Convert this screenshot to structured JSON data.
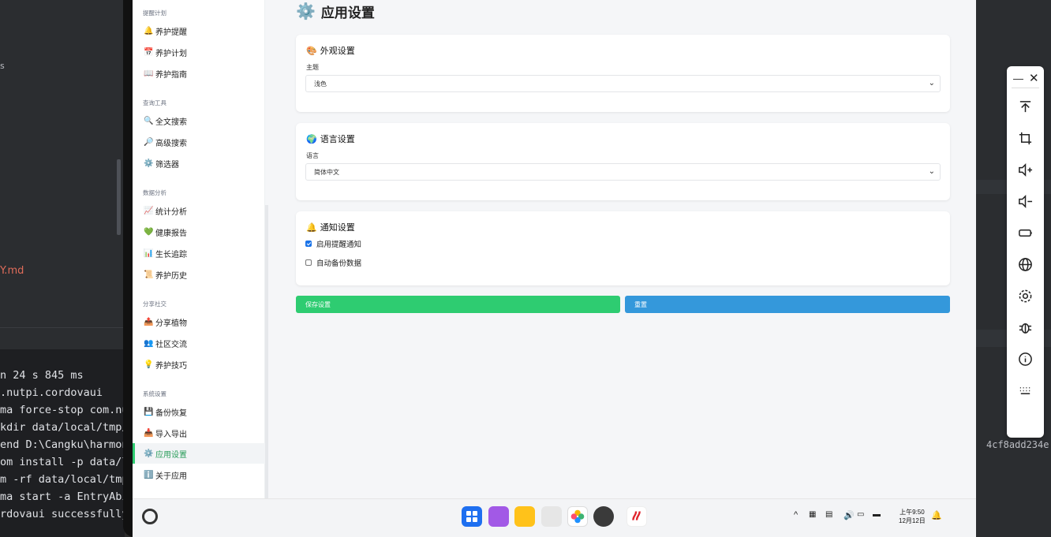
{
  "ide": {
    "left_fragment_s": "s",
    "left_fragment_md": "Y.md",
    "terminal_lines": [
      "n 24 s 845 ms",
      ".nutpi.cordovaui",
      "ma force-stop com.nutp",
      "kdir data/local/tmp/",
      "end D:\\Cangku\\harmon",
      "om install -p data/l",
      "m -rf data/local/tmp",
      "ma start -a EntryAbi",
      "rdovaui successfully"
    ],
    "right_hash": "4cf8add234e"
  },
  "sidebar": {
    "sections": [
      {
        "label": "提醒计划",
        "items": [
          {
            "icon": "🔔",
            "label": "养护提醒"
          },
          {
            "icon": "📅",
            "label": "养护计划"
          },
          {
            "icon": "📖",
            "label": "养护指南"
          }
        ]
      },
      {
        "label": "查询工具",
        "items": [
          {
            "icon": "🔍",
            "label": "全文搜索"
          },
          {
            "icon": "🔎",
            "label": "高级搜索"
          },
          {
            "icon": "⚙️",
            "label": "筛选器"
          }
        ]
      },
      {
        "label": "数据分析",
        "items": [
          {
            "icon": "📈",
            "label": "统计分析"
          },
          {
            "icon": "💚",
            "label": "健康报告"
          },
          {
            "icon": "📊",
            "label": "生长追踪"
          },
          {
            "icon": "📜",
            "label": "养护历史"
          }
        ]
      },
      {
        "label": "分享社交",
        "items": [
          {
            "icon": "📤",
            "label": "分享植物"
          },
          {
            "icon": "👥",
            "label": "社区交流"
          },
          {
            "icon": "💡",
            "label": "养护技巧"
          }
        ]
      },
      {
        "label": "系统设置",
        "items": [
          {
            "icon": "💾",
            "label": "备份恢复"
          },
          {
            "icon": "📥",
            "label": "导入导出"
          },
          {
            "icon": "⚙️",
            "label": "应用设置"
          },
          {
            "icon": "ℹ️",
            "label": "关于应用"
          }
        ]
      }
    ]
  },
  "page": {
    "title_icon": "⚙️",
    "title": "应用设置",
    "appearance": {
      "emoji": "🎨",
      "title": "外观设置",
      "label": "主题",
      "value": "浅色"
    },
    "language": {
      "emoji": "🌍",
      "title": "语言设置",
      "label": "语言",
      "value": "简体中文"
    },
    "notification": {
      "emoji": "🔔",
      "title": "通知设置",
      "options": [
        {
          "label": "启用提醒通知",
          "checked": true
        },
        {
          "label": "自动备份数据",
          "checked": false
        }
      ]
    },
    "save_button": "保存设置",
    "reset_button": "重置"
  },
  "taskbar": {
    "time": "上午9:50",
    "date": "12月12日"
  },
  "colors": {
    "save": "#2ecc71",
    "reset": "#3498db",
    "active_text": "#2a9d5a"
  }
}
